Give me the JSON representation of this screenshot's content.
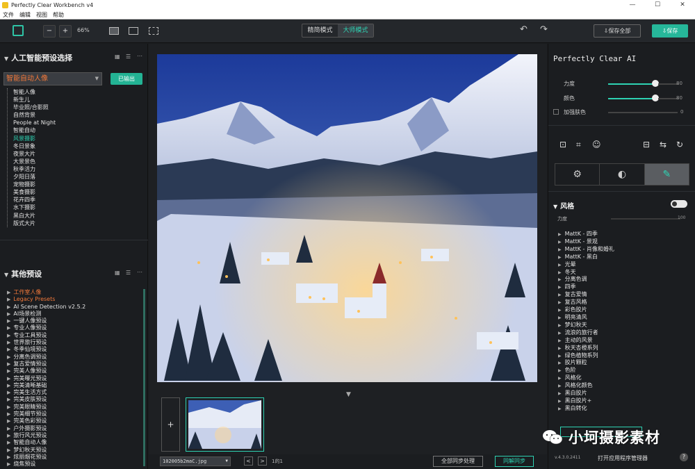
{
  "window": {
    "title": "Perfectly Clear Workbench v4",
    "controls": [
      "—",
      "☐",
      "✕"
    ]
  },
  "menu": [
    "文件",
    "编辑",
    "视图",
    "帮助"
  ],
  "toolbar": {
    "minus": "−",
    "plus": "+",
    "zoom": "66%",
    "mode_simple": "精简模式",
    "mode_master": "大师模式",
    "undo": "↶",
    "redo": "↷",
    "save_all": "⇩保存全部",
    "save": "⇩保存"
  },
  "left": {
    "ai_header": "人工智能预设选择",
    "selected_preset": "智能自动人像",
    "export_label": "已输出",
    "presets": [
      "智能人像",
      "新生儿",
      "毕业照/合影照",
      "自然背景",
      "People at Night",
      "智能自动",
      "风景摄影",
      "冬日景象",
      "夜景大片",
      "大景景色",
      "秋季活力",
      "夕阳日落",
      "宠物摄影",
      "美食摄影",
      "花卉四季",
      "水下摄影",
      "黑白大片",
      "版式大片"
    ],
    "selected_index": 6,
    "other_header": "其他预设",
    "other": [
      "工作室人像",
      "Legacy Presets",
      "AI Scene Detection v2.5.2",
      "AI场景检测",
      "一键人像预设",
      "专业人像预设",
      "专业工具预设",
      "世界旅行预设",
      "冬季仙境预设",
      "分离色调预设",
      "复古爱情预设",
      "完美人像预设",
      "完美曝光预设",
      "完美清晰基础",
      "完美生活方式",
      "完美皮肤预设",
      "完美眼睛预设",
      "完美细节预设",
      "完美色彩预设",
      "户外摄影预设",
      "旅行风光预设",
      "智能自动人像",
      "梦幻秋天预设",
      "炫丽烟花预设",
      "烧焦预设"
    ],
    "other_highlight": [
      0,
      1
    ]
  },
  "center": {
    "filename": "102005b2maC.jpg",
    "prev": "<",
    "next": ">",
    "count": "1的1",
    "sync_all": "全部同步处理",
    "sync": "同解同步",
    "add": "+",
    "down": "▼"
  },
  "right": {
    "ai_title": "Perfectly Clear AI",
    "sliders": [
      {
        "label": "力度",
        "value": "80",
        "level": 80
      },
      {
        "label": "颜色",
        "value": "80",
        "level": 80
      }
    ],
    "checkbox": {
      "label": "加强肤色",
      "value": "0"
    },
    "tools_left": [
      "⊡",
      "⌗",
      "☺"
    ],
    "tools_right": [
      "⊟",
      "⇆",
      "↻"
    ],
    "tabs": [
      "⚙",
      "◐",
      "✎"
    ],
    "style_header": "风格",
    "strength_label": "力度",
    "strength_value": "100",
    "styles": [
      "MattK - 四季",
      "MattK - 景观",
      "MattK - 肖像和婚礼",
      "MattK - 黑白",
      "光晕",
      "冬天",
      "分离色调",
      "四季",
      "复古爱情",
      "复古风格",
      "彩色胶片",
      "明亮清风",
      "梦幻秋天",
      "流浪的旅行者",
      "主动的风景",
      "秋天杏橙系列",
      "绿色植物系列",
      "胶片颗粒",
      "色阶",
      "风格化",
      "风格化颜色",
      "黑白胶片",
      "黑白胶片+",
      "黑白转化"
    ],
    "version": "v.4.3.0.2411",
    "program_manager": "打开应用程序管理器",
    "help": "?"
  },
  "watermark": "小坷摄影素材",
  "colors": {
    "accent": "#2ed3b3",
    "orange": "#f0783a",
    "bg": "#1b1d20"
  }
}
